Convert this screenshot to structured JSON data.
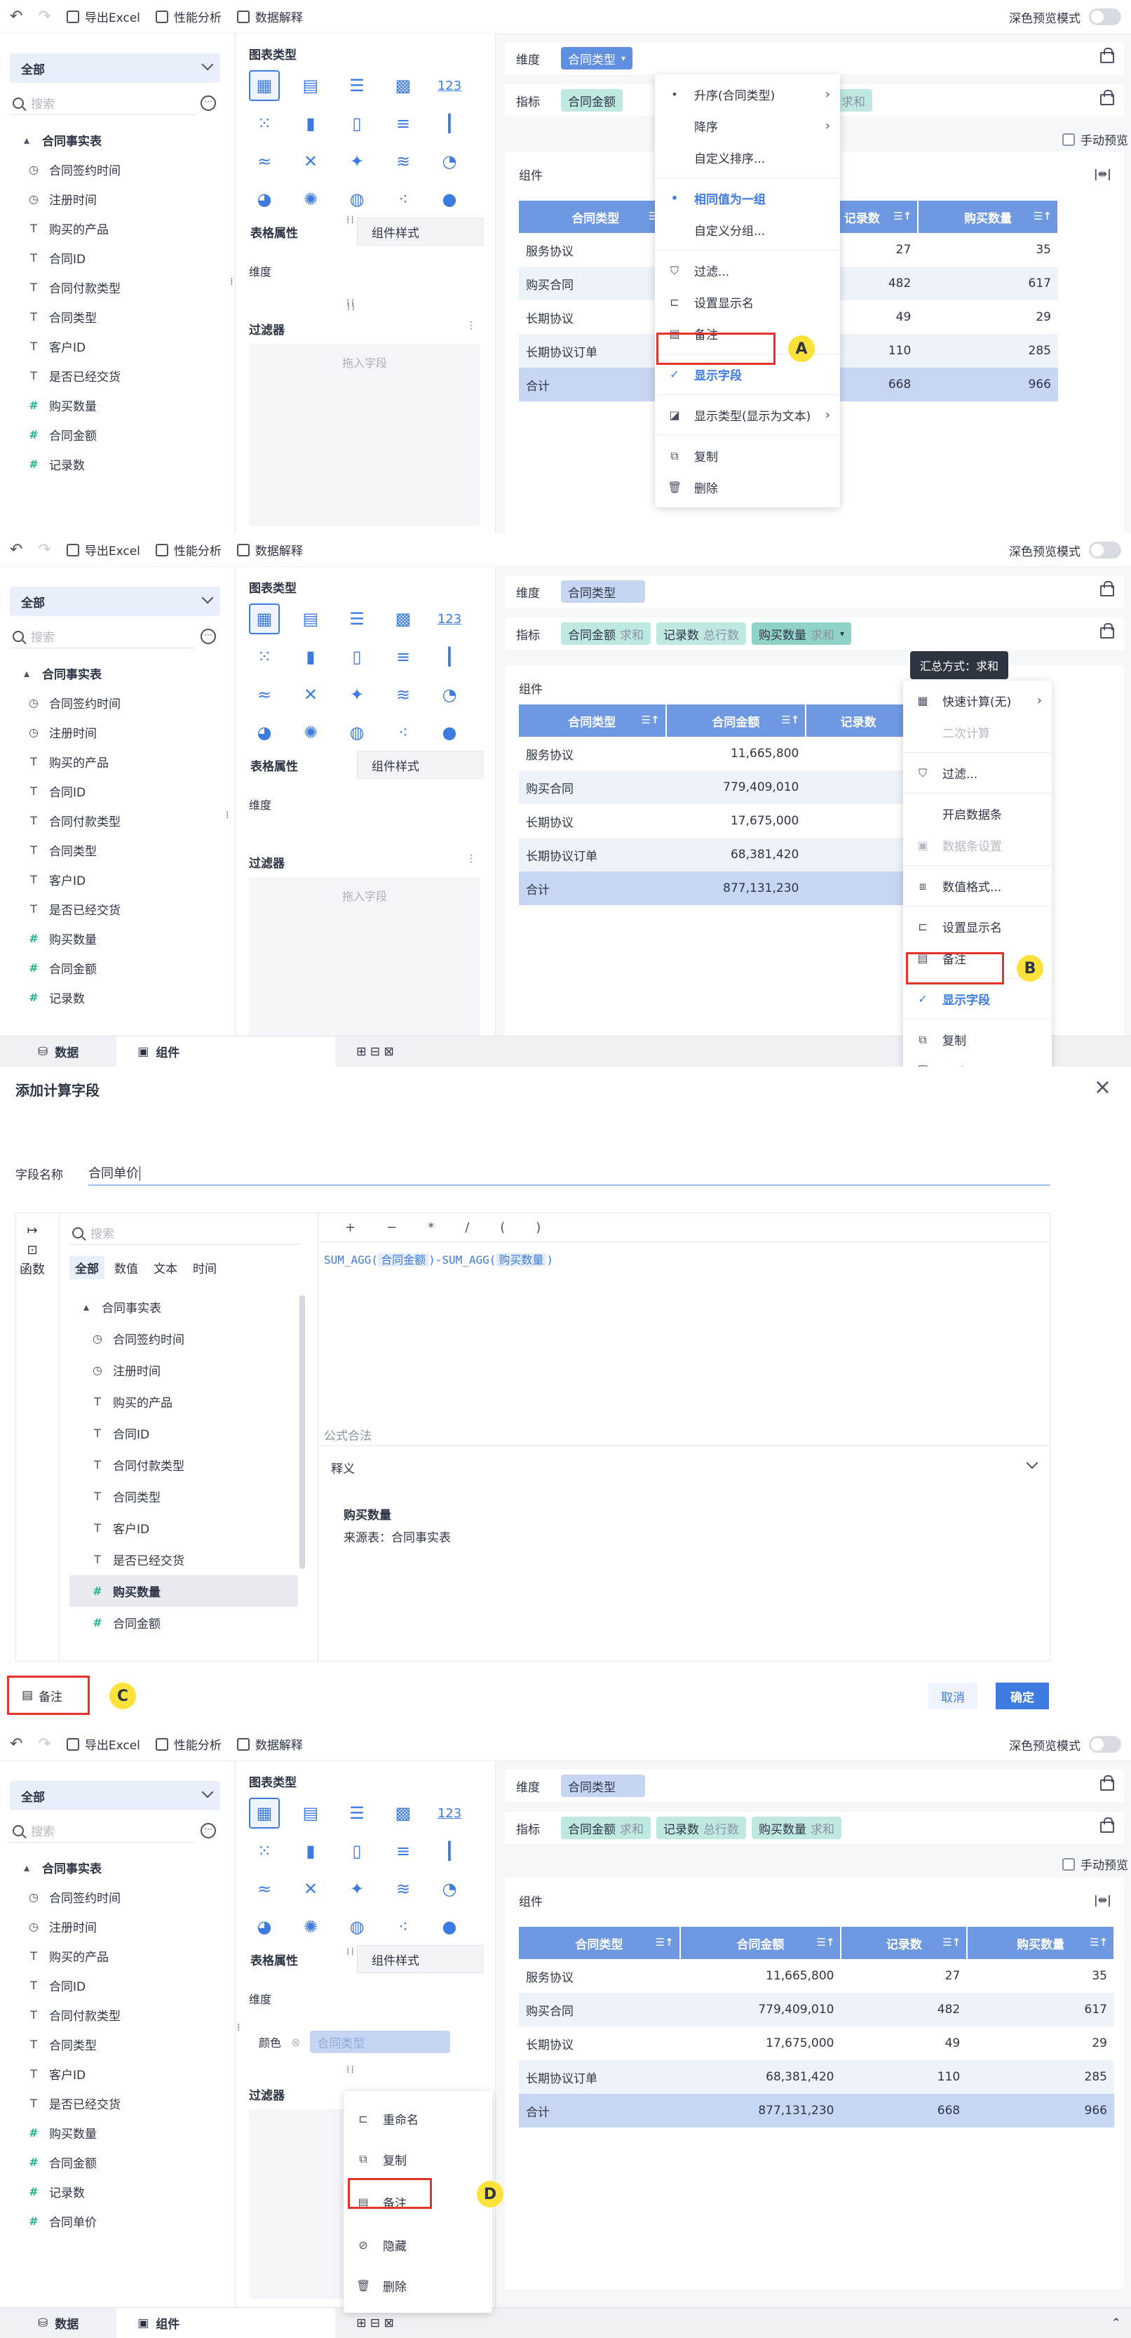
{
  "toolbar": {
    "export_excel": "导出Excel",
    "perf": "性能分析",
    "data_explain": "数据解释",
    "dark_mode": "深色预览模式"
  },
  "left": {
    "all": "全部",
    "search_placeholder": "搜索",
    "more": "···",
    "root": "合同事实表",
    "fields": [
      {
        "icon": "time",
        "label": "合同签约时间"
      },
      {
        "icon": "time",
        "label": "注册时间"
      },
      {
        "icon": "text",
        "label": "购买的产品"
      },
      {
        "icon": "text",
        "label": "合同ID"
      },
      {
        "icon": "text",
        "label": "合同付款类型"
      },
      {
        "icon": "text",
        "label": "合同类型"
      },
      {
        "icon": "text",
        "label": "客户ID"
      },
      {
        "icon": "text",
        "label": "是否已经交货"
      },
      {
        "icon": "num",
        "label": "购买数量"
      },
      {
        "icon": "num",
        "label": "合同金额"
      },
      {
        "icon": "num",
        "label": "记录数"
      }
    ],
    "extra_field": "合同单价"
  },
  "mid": {
    "chart_type": "图表类型",
    "table_attr": "表格属性",
    "comp_style": "组件样式",
    "dimension": "维度",
    "filter": "过滤器",
    "drop_field": "拖入字段",
    "color": "颜色",
    "color_field": "合同类型",
    "chart_icon_123": "123"
  },
  "right": {
    "dim_label": "维度",
    "metric_label": "指标",
    "dim_pill": "合同类型",
    "metrics": [
      {
        "name": "合同金额",
        "agg": "求和"
      },
      {
        "name": "记录数",
        "agg": "总行数"
      },
      {
        "name": "购买数量",
        "agg": "求和"
      }
    ],
    "manual_preview": "手动预览",
    "component": "组件"
  },
  "table": {
    "headers": [
      "合同类型",
      "合同金额",
      "记录数",
      "购买数量"
    ],
    "rows": [
      [
        "服务协议",
        "11,665,800",
        "27",
        "35"
      ],
      [
        "购买合同",
        "779,409,010",
        "482",
        "617"
      ],
      [
        "长期协议",
        "17,675,000",
        "49",
        "29"
      ],
      [
        "长期协议订单",
        "68,381,420",
        "110",
        "285"
      ]
    ],
    "total": [
      "合计",
      "877,131,230",
      "668",
      "966"
    ]
  },
  "menuA": {
    "items": [
      "升序(合同类型)",
      "降序",
      "自定义排序...",
      "相同值为一组",
      "自定义分组...",
      "过滤...",
      "设置显示名",
      "备注",
      "显示字段",
      "显示类型(显示为文本)",
      "复制",
      "删除"
    ],
    "mark": "A"
  },
  "menuB": {
    "tooltip": "汇总方式：求和",
    "items": [
      "快速计算(无)",
      "二次计算",
      "过滤...",
      "开启数据条",
      "数据条设置",
      "数值格式...",
      "设置显示名",
      "备注",
      "显示字段",
      "复制",
      "删除"
    ],
    "mark": "B"
  },
  "bottom": {
    "data_tab": "数据",
    "comp_tab": "组件"
  },
  "dialog": {
    "title": "添加计算字段",
    "field_name_label": "字段名称",
    "field_name_value": "合同单价",
    "side_label": "函数",
    "search": "搜索",
    "tabs": [
      "全部",
      "数值",
      "文本",
      "时间"
    ],
    "ops": [
      "+",
      "−",
      "*",
      "/",
      "(",
      ")"
    ],
    "formula": {
      "f1": "SUM_AGG(",
      "a1": "合同金额",
      "m": ")-SUM_AGG(",
      "a2": "购买数量",
      "e": ")"
    },
    "valid": "公式合法",
    "explain": "释义",
    "explain_title": "购买数量",
    "explain_src": "来源表：合同事实表",
    "note": "备注",
    "mark": "C",
    "cancel": "取消",
    "ok": "确定"
  },
  "menuD": {
    "items": [
      "重命名",
      "复制",
      "备注",
      "隐藏",
      "删除"
    ],
    "mark": "D"
  }
}
